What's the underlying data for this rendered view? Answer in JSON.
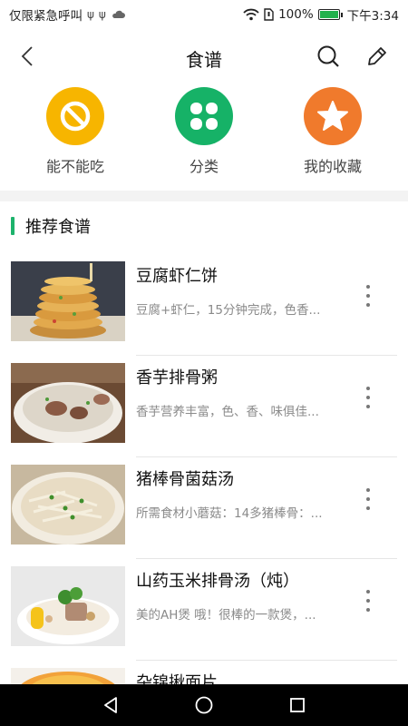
{
  "status_bar": {
    "left_text": "仅限紧急呼叫",
    "left_icons": [
      "usb-icon",
      "usb-icon",
      "cloud-icon"
    ],
    "battery_percent": "100%",
    "battery_level": 1.0,
    "time": "下午3:34"
  },
  "header": {
    "title": "食谱",
    "back_icon": "chevron-left-icon",
    "search_icon": "search-icon",
    "edit_icon": "pencil-icon"
  },
  "quick_actions": [
    {
      "label": "能不能吃",
      "icon": "no-entry-icon",
      "color": "#f7b500"
    },
    {
      "label": "分类",
      "icon": "grid-icon",
      "color": "#16b267"
    },
    {
      "label": "我的收藏",
      "icon": "star-icon",
      "color": "#f07a2c"
    }
  ],
  "section": {
    "title": "推荐食谱",
    "accent": "#1db36c"
  },
  "recipes": [
    {
      "name": "豆腐虾仁饼",
      "desc": "豆腐+虾仁，15分钟完成，色香..."
    },
    {
      "name": "香芋排骨粥",
      "desc": "香芋营养丰富，色、香、味俱佳..."
    },
    {
      "name": "猪棒骨菌菇汤",
      "desc": "所需食材小蘑菇：14多猪棒骨：..."
    },
    {
      "name": "山药玉米排骨汤（炖）",
      "desc": "美的AH煲 哦！很棒的一款煲，..."
    },
    {
      "name": "杂锦揪面片",
      "desc": ""
    }
  ],
  "nav_bar": [
    "back-triangle-icon",
    "home-circle-icon",
    "recents-square-icon"
  ]
}
